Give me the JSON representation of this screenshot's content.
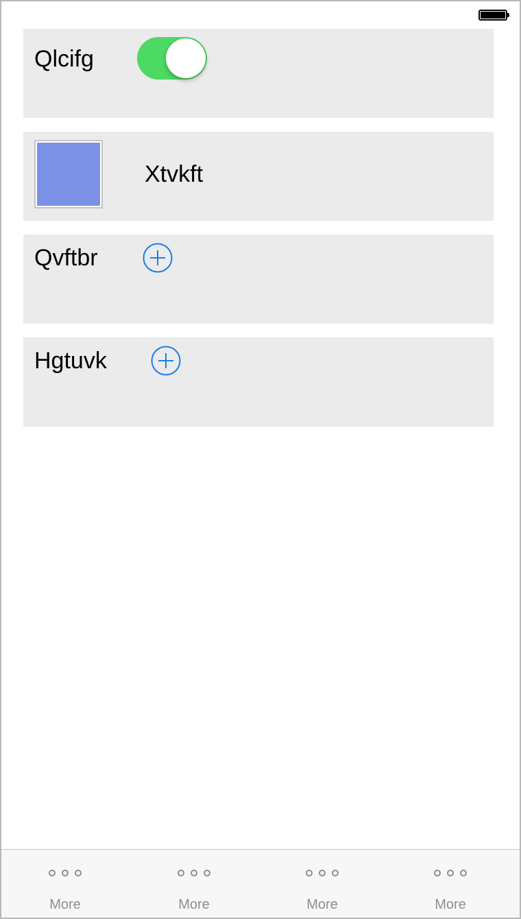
{
  "status_bar": {
    "battery_icon": "battery-full-icon"
  },
  "cells": {
    "switch_cell": {
      "label": "Qlcifg",
      "switch_on": true,
      "switch_color": "#4cd964"
    },
    "color_cell": {
      "label": "Xtvkft",
      "swatch_color": "#7a91e6"
    },
    "add_cell_1": {
      "label": "Qvftbr",
      "icon": "add-circle-icon",
      "icon_color": "#1a7ee6"
    },
    "add_cell_2": {
      "label": "Hgtuvk",
      "icon": "add-circle-icon",
      "icon_color": "#1a7ee6"
    }
  },
  "tab_bar": {
    "items": [
      {
        "label": "More",
        "icon": "more-icon"
      },
      {
        "label": "More",
        "icon": "more-icon"
      },
      {
        "label": "More",
        "icon": "more-icon"
      },
      {
        "label": "More",
        "icon": "more-icon"
      }
    ]
  }
}
